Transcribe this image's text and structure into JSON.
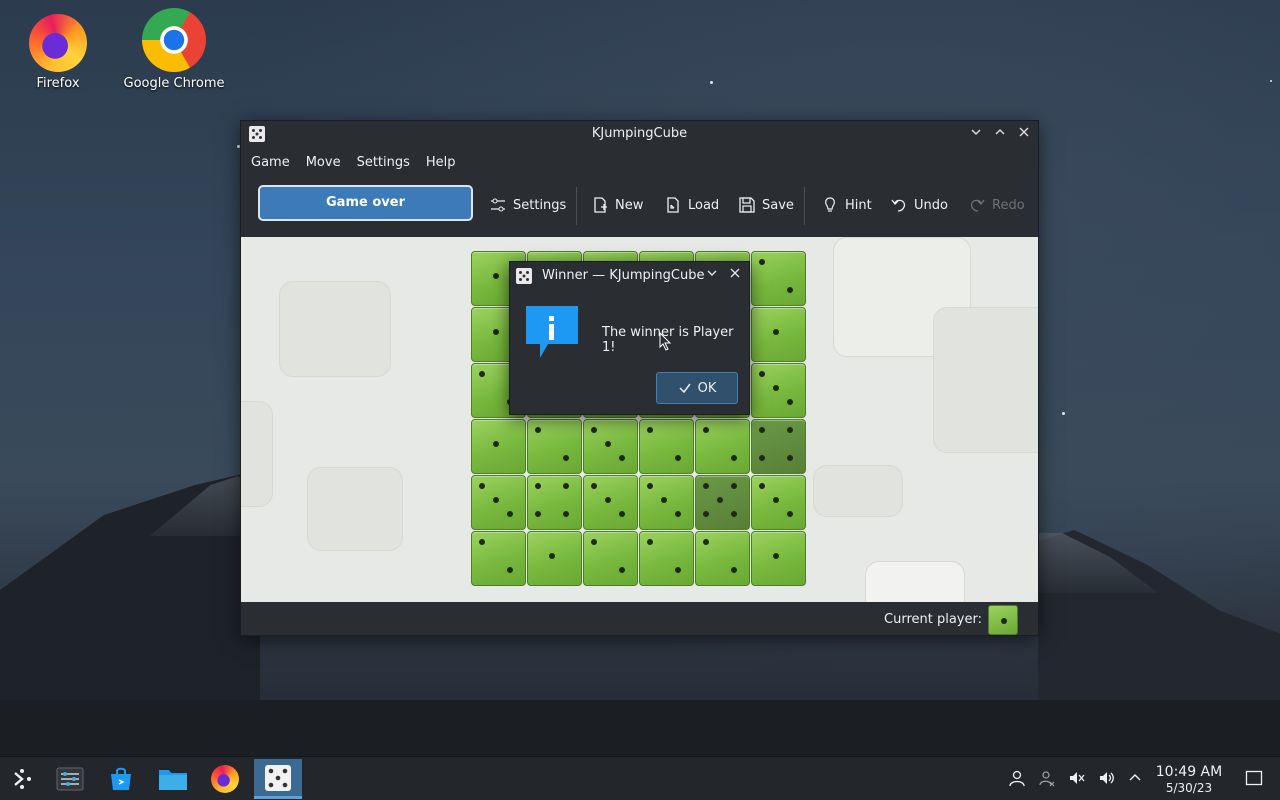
{
  "desktop": {
    "icons": [
      {
        "label": "Firefox",
        "icon": "firefox-icon"
      },
      {
        "label": "Google Chrome",
        "icon": "chrome-icon"
      }
    ]
  },
  "window": {
    "title": "KJumpingCube",
    "menu": [
      "Game",
      "Move",
      "Settings",
      "Help"
    ],
    "toolbar": {
      "status_button": "Game over",
      "settings": "Settings",
      "new": "New",
      "load": "Load",
      "save": "Save",
      "hint": "Hint",
      "undo": "Undo",
      "redo": "Redo"
    },
    "board": {
      "size": 6,
      "cubes": [
        [
          1,
          0,
          0,
          0,
          0,
          2
        ],
        [
          1,
          0,
          0,
          0,
          0,
          1
        ],
        [
          2,
          0,
          0,
          0,
          0,
          3
        ],
        [
          1,
          2,
          3,
          2,
          2,
          4
        ],
        [
          3,
          4,
          3,
          3,
          5,
          3
        ],
        [
          2,
          1,
          2,
          2,
          2,
          1
        ]
      ],
      "highlighted": [
        [
          3,
          5
        ],
        [
          4,
          4
        ]
      ]
    },
    "status": {
      "current_player_label": "Current player:"
    }
  },
  "dialog": {
    "title": "Winner — KJumpingCube",
    "message": "The winner is Player 1!",
    "ok_label": "OK"
  },
  "taskbar": {
    "time": "10:49 AM",
    "date": "5/30/23"
  }
}
